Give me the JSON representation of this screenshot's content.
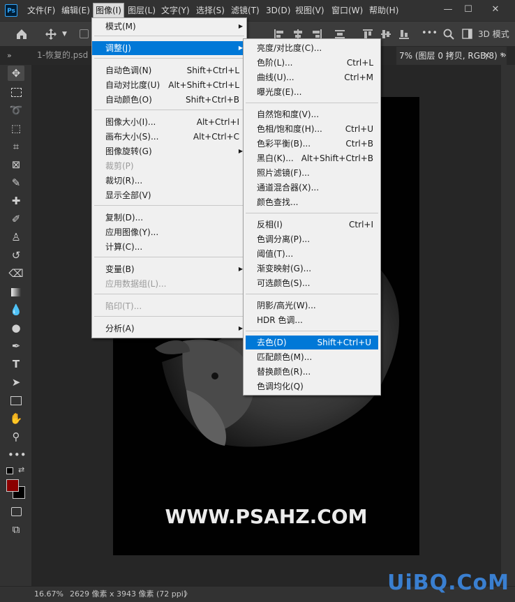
{
  "app": {
    "logo_text": "Ps"
  },
  "menubar": {
    "items": [
      "文件(F)",
      "编辑(E)",
      "图像(I)",
      "图层(L)",
      "文字(Y)",
      "选择(S)",
      "滤镜(T)",
      "3D(D)",
      "视图(V)",
      "窗口(W)",
      "帮助(H)"
    ],
    "active_index": 2,
    "window_controls": [
      "—",
      "☐",
      "✕"
    ]
  },
  "options_bar": {
    "mode_label": "3D 模式"
  },
  "tabs": {
    "expand": "»",
    "first": "1-恢复的.psd",
    "current": "7% (图层 0 拷贝, RGB/8) *",
    "close": "×",
    "overflow": "»"
  },
  "image_menu": {
    "items": [
      {
        "label": "模式(M)",
        "shortcut": "",
        "submenu": true
      },
      {
        "label": "调整(J)",
        "shortcut": "",
        "submenu": true,
        "highlight": true
      },
      {
        "label": "自动色调(N)",
        "shortcut": "Shift+Ctrl+L"
      },
      {
        "label": "自动对比度(U)",
        "shortcut": "Alt+Shift+Ctrl+L"
      },
      {
        "label": "自动颜色(O)",
        "shortcut": "Shift+Ctrl+B"
      },
      {
        "label": "图像大小(I)...",
        "shortcut": "Alt+Ctrl+I"
      },
      {
        "label": "画布大小(S)...",
        "shortcut": "Alt+Ctrl+C"
      },
      {
        "label": "图像旋转(G)",
        "shortcut": "",
        "submenu": true
      },
      {
        "label": "裁剪(P)",
        "shortcut": "",
        "disabled": true
      },
      {
        "label": "裁切(R)...",
        "shortcut": ""
      },
      {
        "label": "显示全部(V)",
        "shortcut": ""
      },
      {
        "label": "复制(D)...",
        "shortcut": ""
      },
      {
        "label": "应用图像(Y)...",
        "shortcut": ""
      },
      {
        "label": "计算(C)...",
        "shortcut": ""
      },
      {
        "label": "变量(B)",
        "shortcut": "",
        "submenu": true
      },
      {
        "label": "应用数据组(L)...",
        "shortcut": "",
        "disabled": true
      },
      {
        "label": "陷印(T)...",
        "shortcut": "",
        "disabled": true
      },
      {
        "label": "分析(A)",
        "shortcut": "",
        "submenu": true
      }
    ]
  },
  "adjust_menu": {
    "items": [
      {
        "label": "亮度/对比度(C)...",
        "shortcut": ""
      },
      {
        "label": "色阶(L)...",
        "shortcut": "Ctrl+L"
      },
      {
        "label": "曲线(U)...",
        "shortcut": "Ctrl+M"
      },
      {
        "label": "曝光度(E)...",
        "shortcut": ""
      },
      {
        "label": "自然饱和度(V)...",
        "shortcut": ""
      },
      {
        "label": "色相/饱和度(H)...",
        "shortcut": "Ctrl+U"
      },
      {
        "label": "色彩平衡(B)...",
        "shortcut": "Ctrl+B"
      },
      {
        "label": "黑白(K)...",
        "shortcut": "Alt+Shift+Ctrl+B"
      },
      {
        "label": "照片滤镜(F)...",
        "shortcut": ""
      },
      {
        "label": "通道混合器(X)...",
        "shortcut": ""
      },
      {
        "label": "颜色查找...",
        "shortcut": ""
      },
      {
        "label": "反相(I)",
        "shortcut": "Ctrl+I"
      },
      {
        "label": "色调分离(P)...",
        "shortcut": ""
      },
      {
        "label": "阈值(T)...",
        "shortcut": ""
      },
      {
        "label": "渐变映射(G)...",
        "shortcut": ""
      },
      {
        "label": "可选颜色(S)...",
        "shortcut": ""
      },
      {
        "label": "阴影/高光(W)...",
        "shortcut": ""
      },
      {
        "label": "HDR 色调...",
        "shortcut": ""
      },
      {
        "label": "去色(D)",
        "shortcut": "Shift+Ctrl+U",
        "highlight": true
      },
      {
        "label": "匹配颜色(M)...",
        "shortcut": ""
      },
      {
        "label": "替换颜色(R)...",
        "shortcut": ""
      },
      {
        "label": "色调均化(Q)",
        "shortcut": ""
      }
    ]
  },
  "canvas": {
    "watermark": "WWW.PSAHZ.COM"
  },
  "status": {
    "zoom": "16.67%",
    "doc_info": "2629 像素 x 3943 像素 (72 ppi)",
    "arrow": "〉"
  },
  "corner_logo": "UiBQ.CoM",
  "colors": {
    "foreground": "#8b0000",
    "background": "#000000",
    "menu_highlight": "#0078d7"
  }
}
